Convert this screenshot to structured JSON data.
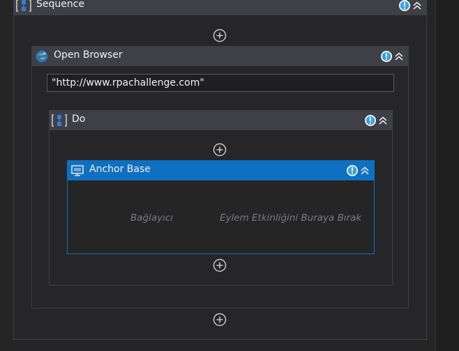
{
  "sequence": {
    "title": "Sequence"
  },
  "open_browser": {
    "title": "Open Browser",
    "url_value": "\"http://www.rpachallenge.com\""
  },
  "do_block": {
    "title": "Do"
  },
  "anchor_base": {
    "title": "Anchor Base",
    "anchor_hint": "Bağlayıcı",
    "action_hint": "Eylem Etkinliğini Buraya Bırak"
  },
  "icons": {
    "sequence": "sequence-icon",
    "browser": "browser-icon",
    "anchor": "anchor-base-icon",
    "info": "info-icon",
    "collapse": "collapse-chevron-icon",
    "add": "add-activity-icon"
  },
  "colors": {
    "canvas": "#252526",
    "header": "#3f3f46",
    "selected": "#0e70c0",
    "info": "#3aa0e8"
  }
}
